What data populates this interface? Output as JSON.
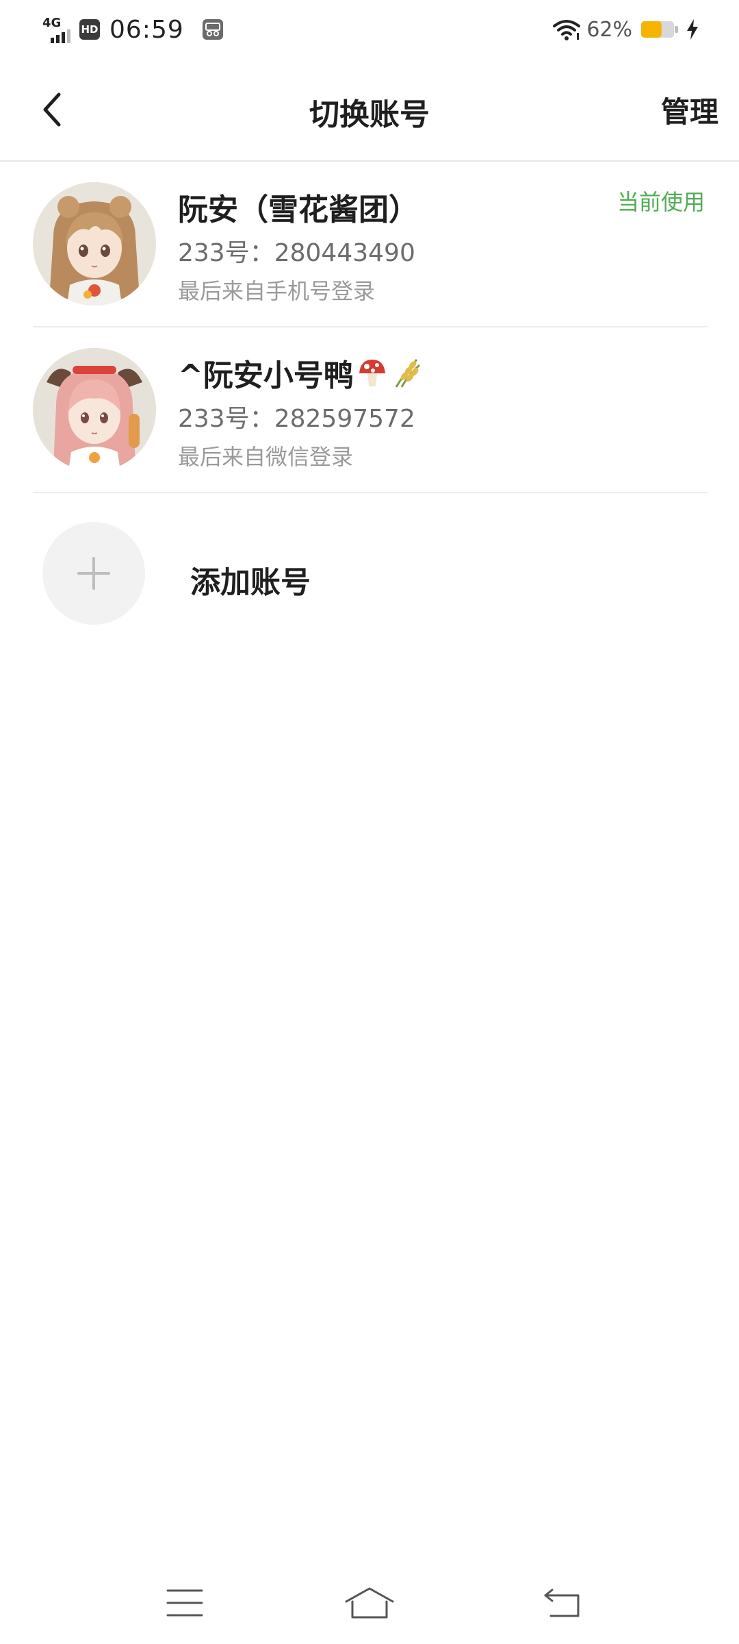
{
  "status_bar": {
    "network_type": "4G",
    "hd_label": "HD",
    "time": "06:59",
    "battery_percent": "62%",
    "battery_level": 0.62,
    "icons": [
      "signal-icon",
      "hd-icon",
      "app-notification-icon",
      "wifi-icon",
      "battery-icon",
      "charging-icon"
    ]
  },
  "header": {
    "title": "切换账号",
    "manage_label": "管理",
    "back_icon": "chevron-left-icon"
  },
  "accounts": [
    {
      "name": "阮安（雪花酱团）",
      "uid": "233号：280443490",
      "login_source": "最后来自手机号登录",
      "badge": "当前使用",
      "avatar_icon": "anime-girl-avatar"
    },
    {
      "name": "^阮安小号鸭",
      "name_emojis": [
        "mushroom-icon",
        "rice-icon"
      ],
      "uid": "233号：282597572",
      "login_source": "最后来自微信登录",
      "avatar_icon": "anime-girl-avatar"
    }
  ],
  "add_account": {
    "label": "添加账号",
    "icon": "plus-icon"
  },
  "nav_bar": {
    "icons": [
      "menu-icon",
      "home-icon",
      "back-arrow-icon"
    ]
  },
  "colors": {
    "accent_green": "#4caf50",
    "battery_yellow": "#f5b400",
    "divider": "#ececec"
  }
}
